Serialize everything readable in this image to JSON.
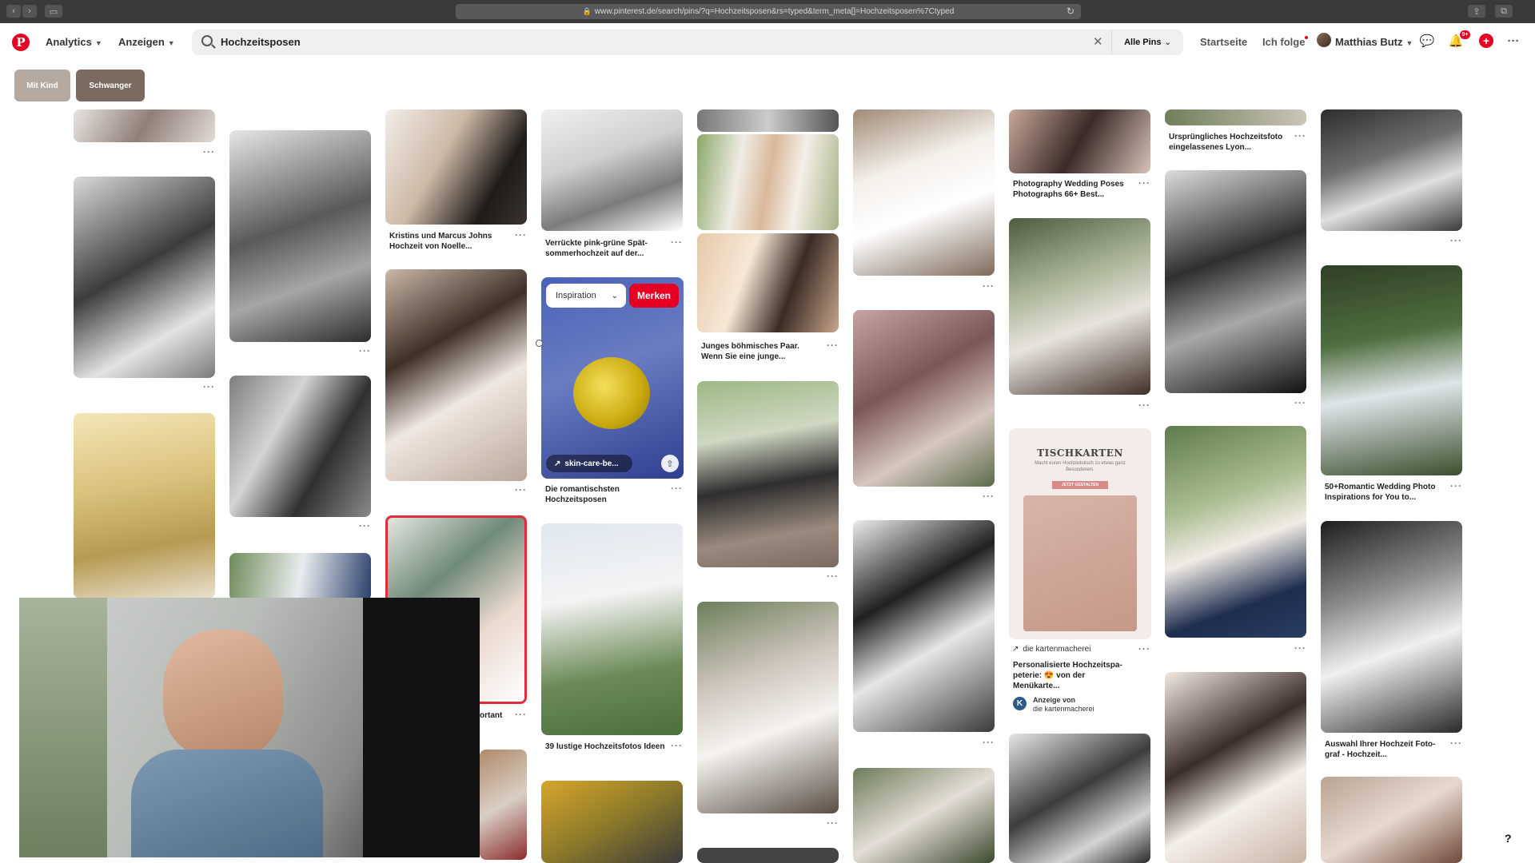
{
  "browser": {
    "url": "www.pinterest.de/search/pins/?q=Hochzeitsposen&rs=typed&term_meta[]=Hochzeitsposen%7Ctyped"
  },
  "header": {
    "nav": {
      "analytics": "Analytics",
      "ads": "Anzeigen"
    },
    "search": {
      "query": "Hochzeitsposen",
      "scope": "Alle Pins"
    },
    "links": {
      "home": "Startseite",
      "following": "Ich folge",
      "user": "Matthias Butz"
    },
    "notification_count": "9+"
  },
  "filters": [
    {
      "label": "Mit Kind",
      "color": "#b5a99f"
    },
    {
      "label": "Schwanger",
      "color": "#7a6a5f"
    }
  ],
  "pins": {
    "c3_title": "Kristins und Marcus Johns Hochzeit von Noelle...",
    "c4_title": "Verrückte pink-grüne Spät-sommerhochzeit auf der...",
    "c4_hover_title": "Die romantischsten Hochzeitsposen",
    "c4_bottom_title": "39 lustige Hochzeitsfotos Ideen",
    "c5_title": "Junges böhmisches Paar. Wenn Sie eine junge...",
    "c7_top_title": "Photography Wedding Poses Photographs 66+ Best...",
    "c8_top_title": "Ursprüngliches Hochzeitsfoto eingelassenes Lyon...",
    "c9_mid_title": "50+Romantic Wedding Photo Inspirations for You to...",
    "c9_bottom_title": "Auswahl Ihrer Hochzeit Foto-graf - Hochzeit...",
    "c3_partial_title": "ortant"
  },
  "hover_pin": {
    "board_select": "Inspiration",
    "save_label": "Merken",
    "source_link": "skin-care-be..."
  },
  "ad_pin": {
    "heading": "TISCHKARTEN",
    "subheading": "Macht euren Hochzeitstisch zu etwas ganz Besonderem.",
    "cta": "JETZT GESTALTEN",
    "source": "die kartenmacherei",
    "title": "Personalisierte Hochzeitspa-peterie: 😍 von der Menükarte...",
    "ad_label": "Anzeige von",
    "advertiser": "die kartenmacherei"
  },
  "more_icon": "···",
  "help": "?"
}
